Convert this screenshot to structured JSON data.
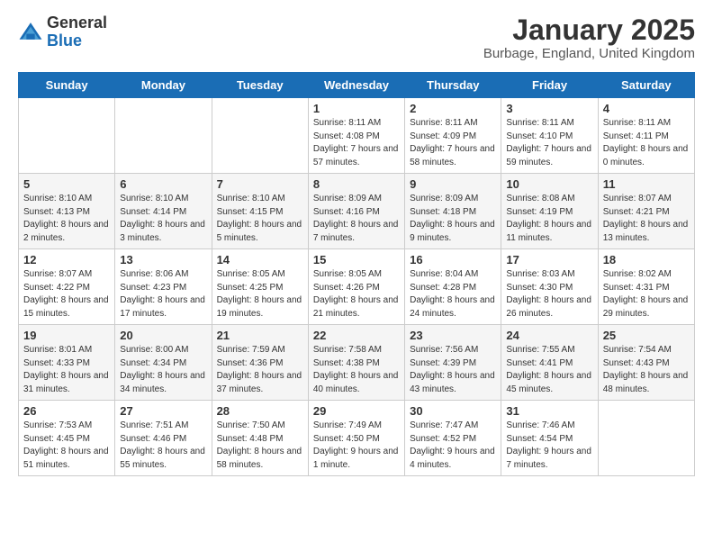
{
  "logo": {
    "general": "General",
    "blue": "Blue"
  },
  "title": "January 2025",
  "location": "Burbage, England, United Kingdom",
  "days_header": [
    "Sunday",
    "Monday",
    "Tuesday",
    "Wednesday",
    "Thursday",
    "Friday",
    "Saturday"
  ],
  "weeks": [
    [
      {
        "day": "",
        "info": ""
      },
      {
        "day": "",
        "info": ""
      },
      {
        "day": "",
        "info": ""
      },
      {
        "day": "1",
        "info": "Sunrise: 8:11 AM\nSunset: 4:08 PM\nDaylight: 7 hours and 57 minutes."
      },
      {
        "day": "2",
        "info": "Sunrise: 8:11 AM\nSunset: 4:09 PM\nDaylight: 7 hours and 58 minutes."
      },
      {
        "day": "3",
        "info": "Sunrise: 8:11 AM\nSunset: 4:10 PM\nDaylight: 7 hours and 59 minutes."
      },
      {
        "day": "4",
        "info": "Sunrise: 8:11 AM\nSunset: 4:11 PM\nDaylight: 8 hours and 0 minutes."
      }
    ],
    [
      {
        "day": "5",
        "info": "Sunrise: 8:10 AM\nSunset: 4:13 PM\nDaylight: 8 hours and 2 minutes."
      },
      {
        "day": "6",
        "info": "Sunrise: 8:10 AM\nSunset: 4:14 PM\nDaylight: 8 hours and 3 minutes."
      },
      {
        "day": "7",
        "info": "Sunrise: 8:10 AM\nSunset: 4:15 PM\nDaylight: 8 hours and 5 minutes."
      },
      {
        "day": "8",
        "info": "Sunrise: 8:09 AM\nSunset: 4:16 PM\nDaylight: 8 hours and 7 minutes."
      },
      {
        "day": "9",
        "info": "Sunrise: 8:09 AM\nSunset: 4:18 PM\nDaylight: 8 hours and 9 minutes."
      },
      {
        "day": "10",
        "info": "Sunrise: 8:08 AM\nSunset: 4:19 PM\nDaylight: 8 hours and 11 minutes."
      },
      {
        "day": "11",
        "info": "Sunrise: 8:07 AM\nSunset: 4:21 PM\nDaylight: 8 hours and 13 minutes."
      }
    ],
    [
      {
        "day": "12",
        "info": "Sunrise: 8:07 AM\nSunset: 4:22 PM\nDaylight: 8 hours and 15 minutes."
      },
      {
        "day": "13",
        "info": "Sunrise: 8:06 AM\nSunset: 4:23 PM\nDaylight: 8 hours and 17 minutes."
      },
      {
        "day": "14",
        "info": "Sunrise: 8:05 AM\nSunset: 4:25 PM\nDaylight: 8 hours and 19 minutes."
      },
      {
        "day": "15",
        "info": "Sunrise: 8:05 AM\nSunset: 4:26 PM\nDaylight: 8 hours and 21 minutes."
      },
      {
        "day": "16",
        "info": "Sunrise: 8:04 AM\nSunset: 4:28 PM\nDaylight: 8 hours and 24 minutes."
      },
      {
        "day": "17",
        "info": "Sunrise: 8:03 AM\nSunset: 4:30 PM\nDaylight: 8 hours and 26 minutes."
      },
      {
        "day": "18",
        "info": "Sunrise: 8:02 AM\nSunset: 4:31 PM\nDaylight: 8 hours and 29 minutes."
      }
    ],
    [
      {
        "day": "19",
        "info": "Sunrise: 8:01 AM\nSunset: 4:33 PM\nDaylight: 8 hours and 31 minutes."
      },
      {
        "day": "20",
        "info": "Sunrise: 8:00 AM\nSunset: 4:34 PM\nDaylight: 8 hours and 34 minutes."
      },
      {
        "day": "21",
        "info": "Sunrise: 7:59 AM\nSunset: 4:36 PM\nDaylight: 8 hours and 37 minutes."
      },
      {
        "day": "22",
        "info": "Sunrise: 7:58 AM\nSunset: 4:38 PM\nDaylight: 8 hours and 40 minutes."
      },
      {
        "day": "23",
        "info": "Sunrise: 7:56 AM\nSunset: 4:39 PM\nDaylight: 8 hours and 43 minutes."
      },
      {
        "day": "24",
        "info": "Sunrise: 7:55 AM\nSunset: 4:41 PM\nDaylight: 8 hours and 45 minutes."
      },
      {
        "day": "25",
        "info": "Sunrise: 7:54 AM\nSunset: 4:43 PM\nDaylight: 8 hours and 48 minutes."
      }
    ],
    [
      {
        "day": "26",
        "info": "Sunrise: 7:53 AM\nSunset: 4:45 PM\nDaylight: 8 hours and 51 minutes."
      },
      {
        "day": "27",
        "info": "Sunrise: 7:51 AM\nSunset: 4:46 PM\nDaylight: 8 hours and 55 minutes."
      },
      {
        "day": "28",
        "info": "Sunrise: 7:50 AM\nSunset: 4:48 PM\nDaylight: 8 hours and 58 minutes."
      },
      {
        "day": "29",
        "info": "Sunrise: 7:49 AM\nSunset: 4:50 PM\nDaylight: 9 hours and 1 minute."
      },
      {
        "day": "30",
        "info": "Sunrise: 7:47 AM\nSunset: 4:52 PM\nDaylight: 9 hours and 4 minutes."
      },
      {
        "day": "31",
        "info": "Sunrise: 7:46 AM\nSunset: 4:54 PM\nDaylight: 9 hours and 7 minutes."
      },
      {
        "day": "",
        "info": ""
      }
    ]
  ]
}
